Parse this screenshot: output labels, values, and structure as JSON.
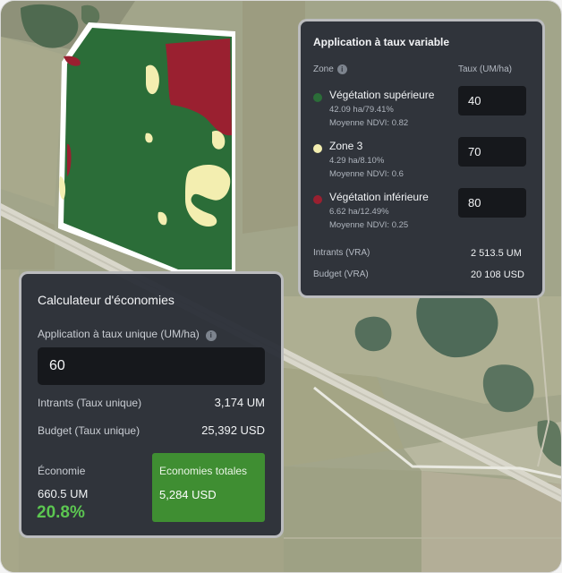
{
  "vra": {
    "title": "Application à taux variable",
    "zone_header": "Zone",
    "rate_header": "Taux (UM/ha)",
    "info_glyph": "i",
    "zones": [
      {
        "name": "Végétation supérieure",
        "stats": "42.09 ha/79.41%",
        "ndvi": "Moyenne NDVI: 0.82",
        "rate": "40",
        "color": "#2b6d38"
      },
      {
        "name": "Zone 3",
        "stats": "4.29 ha/8.10%",
        "ndvi": "Moyenne NDVI: 0.6",
        "rate": "70",
        "color": "#f3eeb0"
      },
      {
        "name": "Végétation inférieure",
        "stats": "6.62 ha/12.49%",
        "ndvi": "Moyenne NDVI: 0.25",
        "rate": "80",
        "color": "#9a2030"
      }
    ],
    "inputs_label": "Intrants (VRA)",
    "inputs_value": "2 513.5 UM",
    "budget_label": "Budget (VRA)",
    "budget_value": "20 108 USD"
  },
  "calc": {
    "title": "Calculateur d'économies",
    "single_rate_label": "Application à taux unique (UM/ha)",
    "info_glyph": "i",
    "single_rate_value": "60",
    "inputs_label": "Intrants (Taux unique)",
    "inputs_value": "3,174 UM",
    "budget_label": "Budget (Taux unique)",
    "budget_value": "25,392 USD",
    "economy_label": "Économie",
    "economy_um": "660.5 UM",
    "economy_pct": "20.8%",
    "totals_label": "Economies totales",
    "totals_value": "5,284 USD"
  },
  "colors": {
    "panel_bg": "#2c3139",
    "accent_green": "#5cc651",
    "totals_bg": "#3f8e32",
    "field_green": "#2b6d38",
    "field_red": "#9a2030",
    "field_yellow": "#f3eeb0"
  }
}
